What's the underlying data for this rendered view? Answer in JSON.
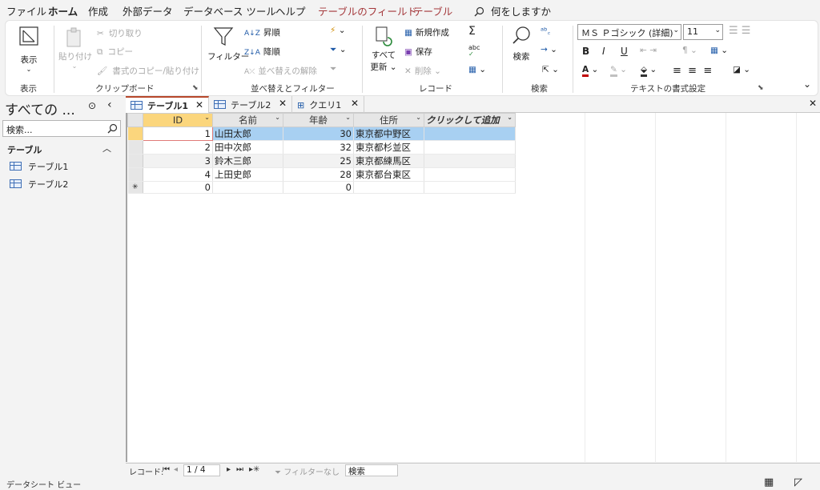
{
  "menu": {
    "tabs": [
      "ファイル",
      "ホーム",
      "作成",
      "外部データ",
      "データベース ツール",
      "ヘルプ",
      "テーブルのフィールド",
      "テーブル"
    ],
    "tell_me": "何をしますか"
  },
  "ribbon": {
    "view": {
      "label": "表示",
      "group": "表示"
    },
    "clipboard": {
      "paste": "貼り付け",
      "cut": "切り取り",
      "copy": "コピー",
      "format_painter": "書式のコピー/貼り付け",
      "group": "クリップボード"
    },
    "sort_filter": {
      "filter": "フィルター",
      "ascending": "昇順",
      "descending": "降順",
      "clear_sort": "並べ替えの解除",
      "group": "並べ替えとフィルター"
    },
    "records": {
      "refresh_all": "すべて",
      "refresh_all2": "更新",
      "new": "新規作成",
      "save": "保存",
      "delete": "削除",
      "group": "レコード"
    },
    "find": {
      "label": "検索",
      "group": "検索"
    },
    "text_format": {
      "font": "ＭＳ Ｐゴシック (詳細)",
      "size": "11",
      "bold": "B",
      "italic": "I",
      "underline": "U",
      "group": "テキストの書式設定"
    }
  },
  "nav": {
    "title": "すべての ...",
    "search_placeholder": "検索...",
    "section": "テーブル",
    "items": [
      "テーブル1",
      "テーブル2"
    ]
  },
  "doc_tabs": [
    "テーブル1",
    "テーブル2",
    "クエリ1"
  ],
  "datasheet": {
    "columns": [
      "ID",
      "名前",
      "年齢",
      "住所",
      "クリックして追加"
    ],
    "rows": [
      {
        "id": "1",
        "name": "山田太郎",
        "age": "30",
        "address": "東京都中野区"
      },
      {
        "id": "2",
        "name": "田中次郎",
        "age": "32",
        "address": "東京都杉並区"
      },
      {
        "id": "3",
        "name": "鈴木三郎",
        "age": "25",
        "address": "東京都練馬区"
      },
      {
        "id": "4",
        "name": "上田史郎",
        "age": "28",
        "address": "東京都台東区"
      }
    ],
    "new_row": {
      "marker": "✳",
      "id": "0",
      "age": "0"
    }
  },
  "record_nav": {
    "label": "レコード:",
    "position": "1 / 4",
    "filter": "フィルターなし",
    "search": "検索"
  },
  "status": {
    "text": "データシート ビュー"
  },
  "colors": {
    "accent": "#b7472a",
    "header_selected": "#fbd67d",
    "row_highlight": "#a8d0f2",
    "context_tab": "#a4373a"
  }
}
